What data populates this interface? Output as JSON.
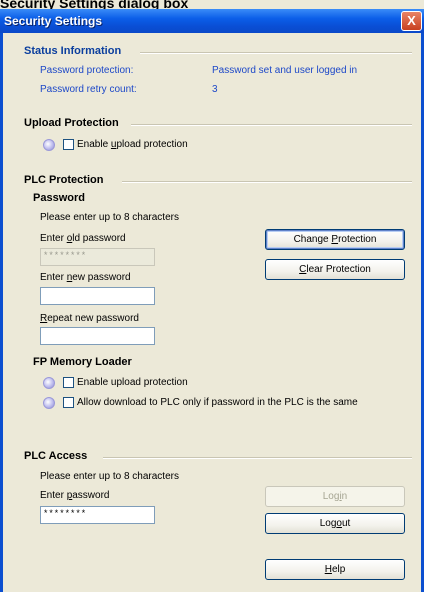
{
  "partial_title": "Security Settings dialog box",
  "window": {
    "title": "Security Settings",
    "close_glyph": "X"
  },
  "status": {
    "heading": "Status Information",
    "rows": [
      {
        "label": "Password protection:",
        "value": "Password set and user logged in"
      },
      {
        "label": "Password retry count:",
        "value": "3"
      }
    ]
  },
  "upload": {
    "heading": "Upload Protection",
    "checkbox": {
      "pre": "Enable ",
      "ul": "u",
      "post": "pload protection",
      "checked": false
    }
  },
  "plc_protection": {
    "heading": "PLC Protection",
    "password_heading": "Password",
    "hint": "Please enter up to 8 characters",
    "old_label": {
      "pre": "Enter ",
      "ul": "o",
      "post": "ld password"
    },
    "old_value": "********",
    "new_label": {
      "pre": "Enter ",
      "ul": "n",
      "post": "ew password"
    },
    "new_value": "",
    "repeat_label": {
      "pre": "",
      "ul": "R",
      "post": "epeat new password"
    },
    "repeat_value": "",
    "change_button": {
      "pre": "Change ",
      "ul": "P",
      "post": "rotection"
    },
    "clear_button": {
      "pre": "",
      "ul": "C",
      "post": "lear Protection"
    }
  },
  "fp_memory": {
    "heading": "FP Memory Loader",
    "options": [
      {
        "text": "Enable upload protection",
        "checked": false
      },
      {
        "text": "Allow download to PLC only if password in the PLC is the same",
        "checked": false
      }
    ]
  },
  "plc_access": {
    "heading": "PLC Access",
    "hint": "Please enter up to 8 characters",
    "label": {
      "pre": "Enter ",
      "ul": "p",
      "post": "assword"
    },
    "value": "********",
    "login_button": {
      "pre": "Log",
      "ul": "i",
      "post": "n"
    },
    "logout_button": {
      "pre": "Log",
      "ul": "o",
      "post": "ut"
    },
    "help_button": {
      "pre": "",
      "ul": "H",
      "post": "elp"
    }
  },
  "colors": {
    "title_bar": "#0a4fd6",
    "dialog_bg": "#ece9d8",
    "accent_blue": "#1d48c8"
  }
}
